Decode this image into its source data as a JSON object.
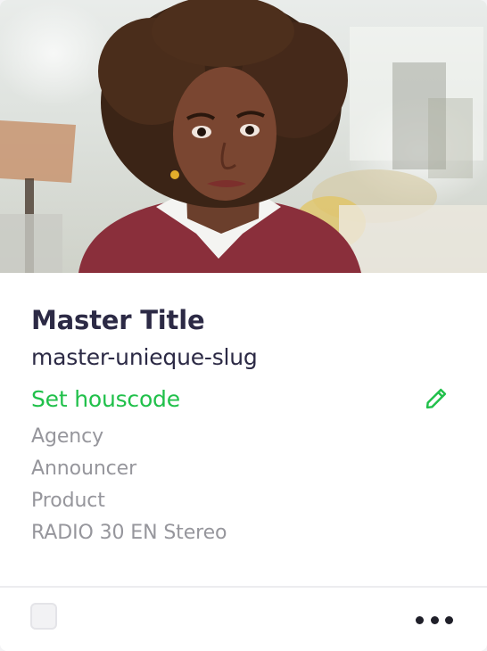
{
  "card": {
    "thumbnail_icon": "video-thumbnail",
    "title": "Master Title",
    "slug": "master-unieque-slug",
    "housecode_link": "Set houscode",
    "edit_icon": "pencil-icon",
    "meta": {
      "agency": "Agency",
      "announcer": "Announcer",
      "product": "Product",
      "format": "RADIO 30 EN Stereo"
    },
    "more_icon": "more-horizontal-icon"
  },
  "colors": {
    "title": "#2c2a45",
    "accent": "#20c04a",
    "meta": "#96969c"
  }
}
